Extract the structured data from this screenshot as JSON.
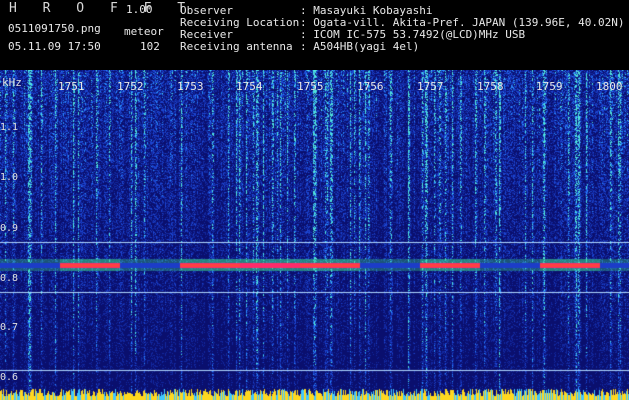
{
  "header": {
    "app_title": "H R O F F T",
    "version": "1.00",
    "filename": "0511091750.png",
    "timestamp": "05.11.09 17:50",
    "meteor_label": "meteor",
    "meteor_count": "102",
    "info": [
      {
        "key": "Observer",
        "value": ": Masayuki Kobayashi"
      },
      {
        "key": "Receiving Location",
        "value": ": Ogata-vill. Akita-Pref. JAPAN (139.96E, 40.02N)"
      },
      {
        "key": "Receiver",
        "value": ": ICOM IC-575 53.7492(@LCD)MHz USB"
      },
      {
        "key": "Receiving antenna",
        "value": ": A504HB(yagi 4el)"
      }
    ]
  },
  "spectrogram": {
    "y_unit": "kHz",
    "y_ticks": [
      "1.1",
      "1.0",
      "0.9",
      "0.8",
      "0.7",
      "0.6"
    ],
    "time_ticks": [
      "1751",
      "1752",
      "1753",
      "1754",
      "1755",
      "1756",
      "1757",
      "1758",
      "1759",
      "1800"
    ],
    "colors": {
      "background": "#0a0f6e",
      "noise": "#1c3cc8",
      "speckle": "#3aa0ff",
      "signal": "#ff2a6a",
      "signal_core": "#ff4040",
      "halo": "#40e090",
      "line": "#b0d8ff",
      "bottom_bar": "#ffd820"
    }
  }
}
